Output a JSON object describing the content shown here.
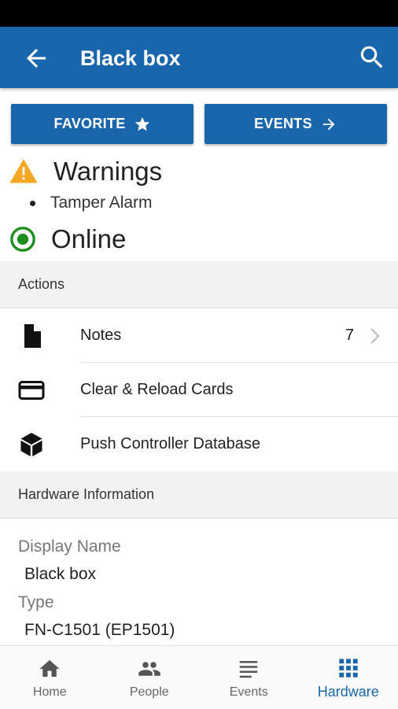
{
  "app_bar": {
    "title": "Black box",
    "back_icon": "arrow-back-icon",
    "search_icon": "search-icon"
  },
  "buttons": {
    "favorite": "FAVORITE",
    "events": "EVENTS"
  },
  "status": {
    "warnings_title": "Warnings",
    "warning_items": [
      "Tamper Alarm"
    ],
    "online_label": "Online",
    "warning_color": "#f5a623",
    "online_color": "#1e8f1e"
  },
  "actions": {
    "header": "Actions",
    "items": [
      {
        "label": "Notes",
        "icon": "document-icon",
        "count": "7"
      },
      {
        "label": "Clear & Reload Cards",
        "icon": "card-icon"
      },
      {
        "label": "Push Controller Database",
        "icon": "cube-icon"
      }
    ]
  },
  "hardware_info": {
    "header": "Hardware Information",
    "fields": [
      {
        "label": "Display Name",
        "value": "Black box"
      },
      {
        "label": "Type",
        "value": "FN-C1501 (EP1501)"
      }
    ]
  },
  "bottom_nav": {
    "items": [
      {
        "label": "Home",
        "icon": "home-icon"
      },
      {
        "label": "People",
        "icon": "people-icon"
      },
      {
        "label": "Events",
        "icon": "list-icon"
      },
      {
        "label": "Hardware",
        "icon": "grid-icon",
        "active": true
      }
    ]
  },
  "colors": {
    "primary": "#1a66ad"
  }
}
